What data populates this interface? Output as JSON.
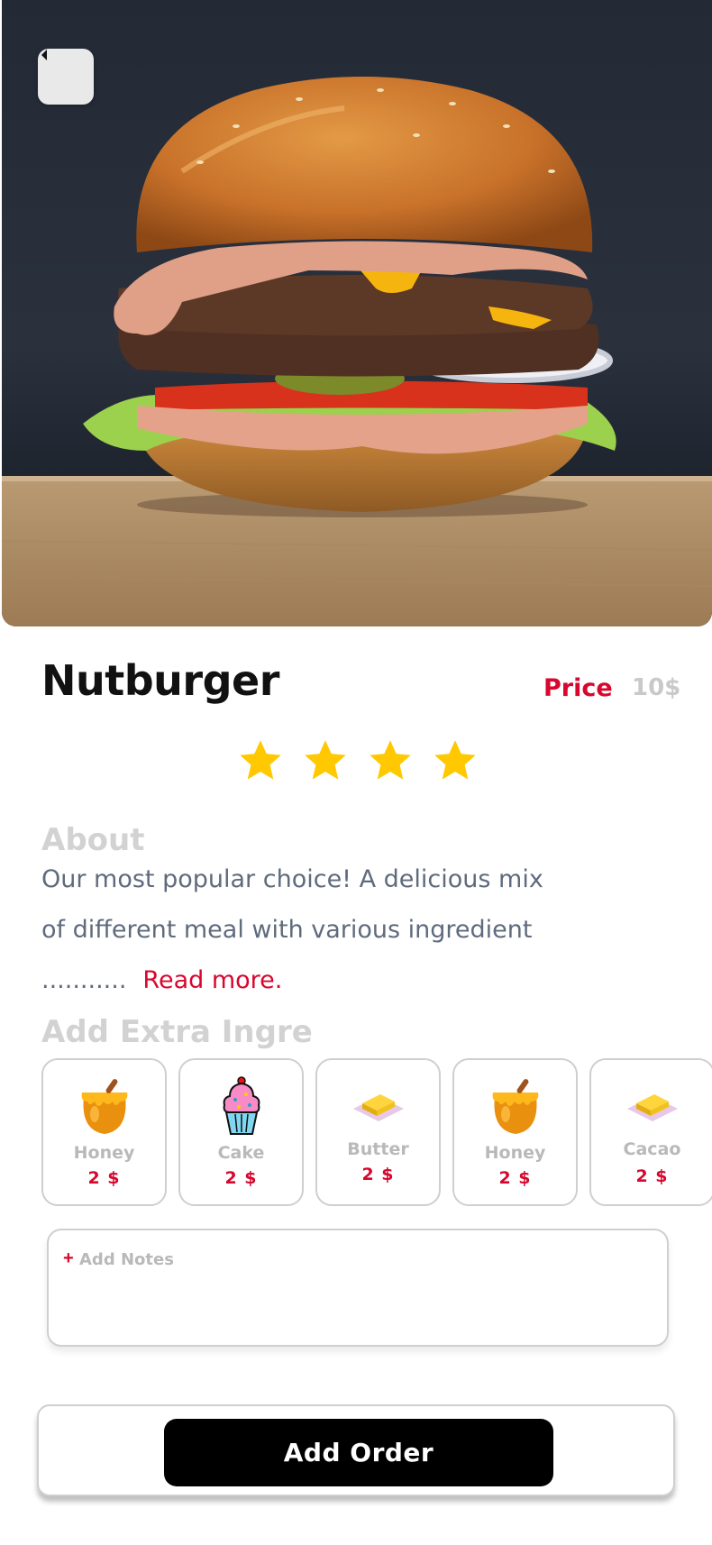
{
  "product": {
    "name": "Nutburger",
    "price_label": "Price",
    "price_value": "10$",
    "rating": 4,
    "rating_max": 4,
    "image_alt_icon": "burger-photo"
  },
  "about": {
    "heading": "About",
    "text": "Our most popular choice! A delicious mix of different meal with various ingredient ...........",
    "read_more": "Read more."
  },
  "extras": {
    "heading": "Add Extra Ingre",
    "items": [
      {
        "name": "Honey",
        "price": "2 $",
        "icon": "honey-pot-icon"
      },
      {
        "name": "Cake",
        "price": "2 $",
        "icon": "cupcake-icon"
      },
      {
        "name": "Butter",
        "price": "2 $",
        "icon": "butter-icon"
      },
      {
        "name": "Honey",
        "price": "2 $",
        "icon": "honey-pot-icon"
      },
      {
        "name": "Cacao",
        "price": "2 $",
        "icon": "butter-icon"
      }
    ]
  },
  "notes": {
    "plus": "+",
    "placeholder": "Add Notes"
  },
  "actions": {
    "add_order": "Add Order"
  },
  "colors": {
    "accent": "#d8072e",
    "star": "#ffc800",
    "muted": "#b9b9b9",
    "button": "#000000"
  }
}
